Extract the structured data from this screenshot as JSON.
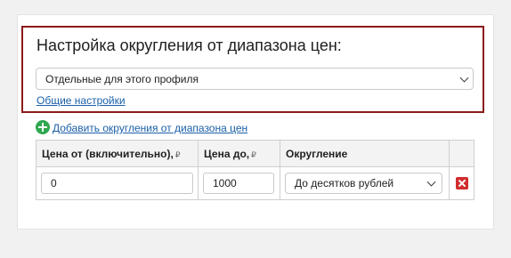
{
  "profile_rounding": {
    "title": "Настройка округления от диапазона цен:",
    "mode_select": {
      "value": "Отдельные для этого профиля"
    },
    "general_settings_link": "Общие настройки"
  },
  "add_range_link": "Добавить округления от диапазона цен",
  "ranges_table": {
    "headers": {
      "price_from": "Цена от (включительно),",
      "price_to": "Цена до,",
      "rounding": "Округление",
      "currency_symbol": "₽"
    },
    "rows": [
      {
        "price_from": "0",
        "price_to": "1000",
        "rounding": "До десятков рублей"
      }
    ]
  },
  "icons": {
    "add": "plus-circle-icon",
    "delete": "delete-x-icon",
    "dropdown": "chevron-down-icon"
  },
  "colors": {
    "highlight_border": "#8b1a1a",
    "link": "#1a5fa8",
    "add_icon": "#2fa84f",
    "delete_icon": "#d12d2d"
  }
}
